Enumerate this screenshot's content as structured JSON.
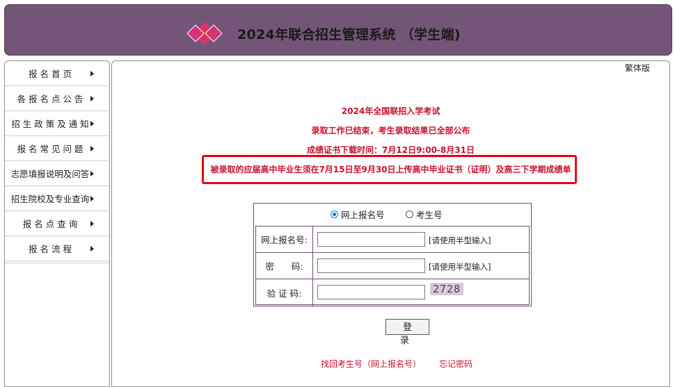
{
  "header": {
    "title": "2024年联合招生管理系统 （学生端)",
    "logo_icon": "diamond-logo-icon",
    "background_color": "#735577"
  },
  "sidebar": {
    "items": [
      {
        "label": "报 名 首 页"
      },
      {
        "label": "各 报 名 点 公 告"
      },
      {
        "label": "招 生 政 策 及 通 知"
      },
      {
        "label": "报 名 常 见 问 题"
      },
      {
        "label": "志愿填报说明及问答"
      },
      {
        "label": "招生院校及专业查询"
      },
      {
        "label": "报 名 点 查 询"
      },
      {
        "label": "报 名 流 程"
      }
    ],
    "arrow_icon": "triangle-right-icon"
  },
  "main": {
    "lang_link": "繁体版",
    "notices": [
      "2024年全国联招入学考试",
      "录取工作已结束，考生录取结果已全部公布",
      "成绩证书下载时间：7月12日9:00-8月31日",
      "被录取的应届高中毕业生须在7月15日至9月30日上传高中毕业证书（证明）及高三下学期成绩单"
    ],
    "notice_color": "#c8102e",
    "highlight_color": "#e60012"
  },
  "login": {
    "radio_options": [
      {
        "label": "网上报名号",
        "checked": true
      },
      {
        "label": "考生号",
        "checked": false
      }
    ],
    "fields": [
      {
        "label": "网上报名号:",
        "value": "",
        "hint": "[请使用半型输入]"
      },
      {
        "label": "密　　码:",
        "value": "",
        "hint": "[请使用半型输入]"
      },
      {
        "label": "验 证 码:",
        "value": "",
        "captcha": "2728"
      }
    ],
    "submit_label": "登 录",
    "links": [
      "找回考生号（网上报名号）",
      "忘记密码"
    ]
  }
}
